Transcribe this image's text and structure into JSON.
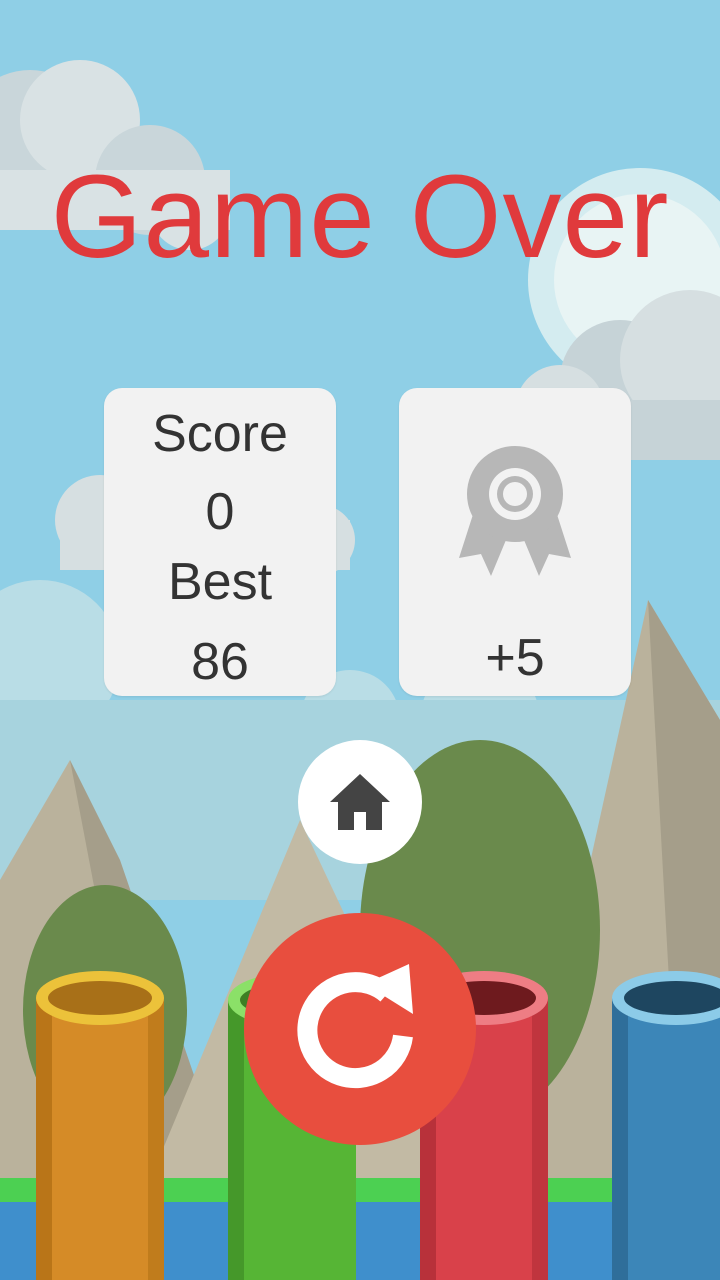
{
  "title": "Game Over",
  "score_panel": {
    "score_label": "Score",
    "score_value": "0",
    "best_label": "Best",
    "best_value": "86"
  },
  "reward_panel": {
    "icon": "ribbon-award-icon",
    "bonus": "+5"
  },
  "buttons": {
    "home_icon": "home-icon",
    "replay_icon": "replay-icon"
  },
  "colors": {
    "title": "#e03a3c",
    "replay": "#e84e3e",
    "pipes": [
      "#d58b27",
      "#56b535",
      "#d9414a",
      "#3c86b8"
    ]
  }
}
